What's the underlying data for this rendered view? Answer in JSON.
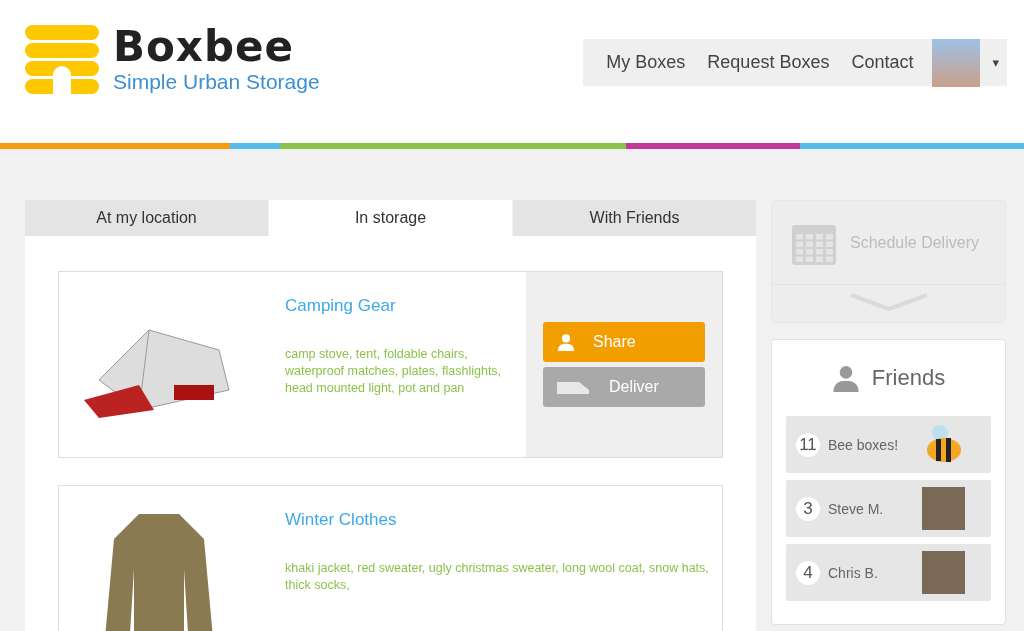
{
  "brand": {
    "name": "Boxbee",
    "tagline": "Simple Urban Storage"
  },
  "nav": {
    "items": [
      "My Boxes",
      "Request Boxes",
      "Contact"
    ],
    "menu_caret": "▾"
  },
  "tabs": [
    {
      "label": "At my location",
      "selected": false
    },
    {
      "label": "In storage",
      "selected": true
    },
    {
      "label": "With Friends",
      "selected": false
    }
  ],
  "boxes": [
    {
      "title": "Camping Gear",
      "contents": "camp stove, tent, foldable chairs, waterproof matches, plates, flashlights, head mounted light, pot and pan",
      "kind": "tent",
      "actions": [
        {
          "label": "Share",
          "kind": "share",
          "disabled": false
        },
        {
          "label": "Deliver",
          "kind": "deliver",
          "disabled": true
        }
      ]
    },
    {
      "title": "Winter Clothes",
      "contents": "khaki jacket, red sweater, ugly christmas sweater, long wool coat, snow hats, thick socks,",
      "kind": "jacket"
    }
  ],
  "schedule": {
    "label": "Schedule Delivery",
    "disabled": true
  },
  "friends": {
    "title": "Friends",
    "items": [
      {
        "count": "11",
        "name": "Bee boxes!",
        "kind": "drawing"
      },
      {
        "count": "3",
        "name": "Steve M.",
        "kind": "photo"
      },
      {
        "count": "4",
        "name": "Chris B.",
        "kind": "photo"
      }
    ]
  }
}
